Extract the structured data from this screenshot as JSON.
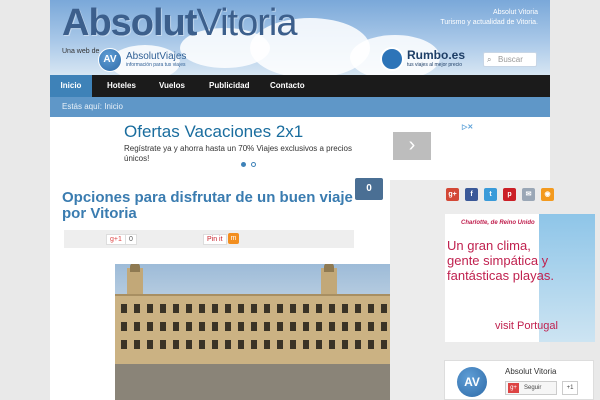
{
  "header": {
    "brand_main": "Absolut",
    "brand_second": "Vitoria",
    "tagline_1": "Absolut Vitoria",
    "tagline_2": "Turismo y actualidad de Vitoria.",
    "web_de": "Una web de",
    "network_logo_letters": "AV",
    "network_name": "AbsolutViajes",
    "network_sub": "información para tus viajes",
    "partner_name": "Rumbo.es",
    "partner_sub": "tus viajes al mejor precio",
    "search_placeholder": "Buscar"
  },
  "nav": {
    "items": [
      {
        "label": "Inicio",
        "active": true
      },
      {
        "label": "Hoteles"
      },
      {
        "label": "Vuelos"
      },
      {
        "label": "Publicidad"
      },
      {
        "label": "Contacto"
      }
    ]
  },
  "breadcrumb": {
    "text": "Estás aquí: Inicio"
  },
  "ad": {
    "title": "Ofertas Vacaciones 2x1",
    "text": "Regístrate ya y ahorra hasta un 70% Viajes exclusivos a precios únicos!",
    "next_glyph": "›",
    "close_glyph": "▷✕"
  },
  "post": {
    "title": "Opciones para disfrutar de un buen viaje por Vitoria",
    "comment_count": "0",
    "share": {
      "gplus_label": "g+1",
      "gplus_count": "0",
      "pin_label": "Pin it",
      "meneame_glyph": "m"
    }
  },
  "sidebar": {
    "social": [
      {
        "name": "google-plus",
        "glyph": "g+",
        "color": "#d34836"
      },
      {
        "name": "facebook",
        "glyph": "f",
        "color": "#3b5998"
      },
      {
        "name": "twitter",
        "glyph": "t",
        "color": "#3a9bd9"
      },
      {
        "name": "pinterest",
        "glyph": "p",
        "color": "#cb2027"
      },
      {
        "name": "email",
        "glyph": "✉",
        "color": "#9aa7b6"
      },
      {
        "name": "rss",
        "glyph": "◉",
        "color": "#f39a1f"
      }
    ],
    "banner": {
      "city": "Charlotte, de Reino Unido",
      "message": "Un gran clima, gente simpática y fantásticas playas.",
      "brand": "visit Portugal"
    },
    "fb": {
      "logo_letters": "AV",
      "name": "Absolut Vitoria",
      "follow": "Seguir",
      "plus": "+1"
    }
  },
  "colors": {
    "accent": "#3e82b8",
    "nav_bg": "#1b1b1b",
    "crumb_bg": "#5f97c8",
    "title": "#3a7cb0"
  }
}
